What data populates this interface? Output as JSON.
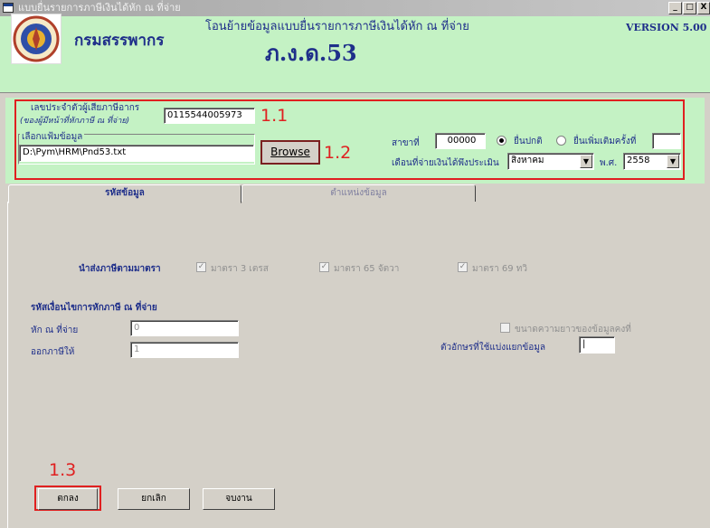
{
  "window": {
    "title": "แบบยื่นรายการภาษีเงินได้หัก ณ ที่จ่าย",
    "minimize": "_",
    "maximize": "□",
    "close": "X"
  },
  "header": {
    "department": "กรมสรรพากร",
    "subtitle": "โอนย้ายข้อมูลแบบยื่นรายการภาษีเงินได้หัก ณ ที่จ่าย",
    "form_code": "ภ.ง.ด.53",
    "version": "VERSION 5.00"
  },
  "settings": {
    "taxid_label": "เลขประจำตัวผู้เสียภาษีอากร",
    "taxid_note": "(ของผู้มีหน้าที่หักภาษี ณ ที่จ่าย)",
    "taxid_value": "0115544005973",
    "file_label": "เลือกแฟ้มข้อมูล",
    "file_value": "D:\\Pym\\HRM\\Pnd53.txt",
    "browse_label": "Browse",
    "branch_label": "สาขาที่",
    "branch_value": "00000",
    "radio_normal": "ยื่นปกติ",
    "radio_additional": "ยื่นเพิ่มเติมครั้งที่",
    "additional_value": "",
    "month_label": "เดือนที่จ่ายเงินได้พึงประเมิน",
    "month_value": "สิงหาคม",
    "year_label": "พ.ศ.",
    "year_value": "2558"
  },
  "annotations": {
    "a1": "1.1",
    "a2": "1.2",
    "a3": "1.3"
  },
  "tabs": [
    {
      "label": "รหัสข้อมูล"
    },
    {
      "label": "ตำแหน่งข้อมูล"
    }
  ],
  "main": {
    "section1_title": "นำส่งภาษีตามมาตรา",
    "checkboxes": [
      {
        "label": "มาตรา 3 เตรส",
        "checked": true
      },
      {
        "label": "มาตรา 65 จัตวา",
        "checked": true
      },
      {
        "label": "มาตรา 69 ทวิ",
        "checked": true
      }
    ],
    "section2_title": "รหัสเงื่อนไขการหักภาษี ณ ที่จ่าย",
    "withhold_label": "หัก ณ ที่จ่าย",
    "withhold_value": "0",
    "issue_label": "ออกภาษีให้",
    "issue_value": "1",
    "length_check_label": "ขนาดความยาวของข้อมูลคงที่",
    "separator_label": "ตัวอักษรที่ใช้แบ่งแยกข้อมูล",
    "separator_value": "|"
  },
  "buttons": {
    "ok": "ตกลง",
    "cancel": "ยกเลิก",
    "exit": "จบงาน"
  }
}
